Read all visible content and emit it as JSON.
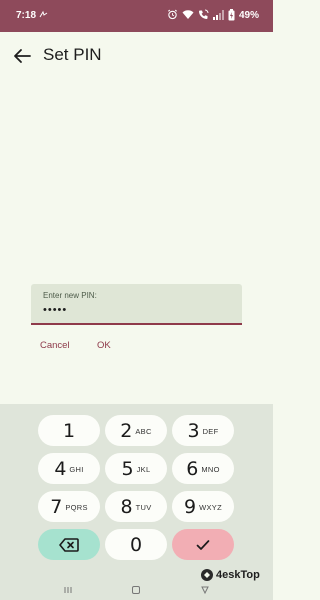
{
  "status_bar": {
    "time": "7:18",
    "battery_percent": "49%",
    "background_color": "#8e4a5b",
    "icons": [
      "notification-icon",
      "alarm-icon",
      "wifi-icon",
      "wifi-calling-icon",
      "signal-icon",
      "battery-charging-icon"
    ]
  },
  "header": {
    "title": "Set PIN",
    "back_icon": "arrow-left-icon"
  },
  "pin_dialog": {
    "field_label": "Enter new PIN:",
    "field_value": "•••••",
    "cancel_label": "Cancel",
    "ok_label": "OK",
    "accent_color": "#8e3a4a"
  },
  "keypad": {
    "keys": [
      {
        "digit": "1",
        "letters": ""
      },
      {
        "digit": "2",
        "letters": "ABC"
      },
      {
        "digit": "3",
        "letters": "DEF"
      },
      {
        "digit": "4",
        "letters": "GHI"
      },
      {
        "digit": "5",
        "letters": "JKL"
      },
      {
        "digit": "6",
        "letters": "MNO"
      },
      {
        "digit": "7",
        "letters": "PQRS"
      },
      {
        "digit": "8",
        "letters": "TUV"
      },
      {
        "digit": "9",
        "letters": "WXYZ"
      },
      {
        "digit": "0",
        "letters": ""
      }
    ],
    "delete_icon": "backspace-icon",
    "done_icon": "checkmark-icon",
    "delete_color": "#a6e2cf",
    "done_color": "#f2aeb4"
  },
  "nav_bar": {
    "icons": [
      "recents-icon",
      "home-icon",
      "back-icon"
    ]
  },
  "watermark": {
    "text": "4eskTop"
  }
}
